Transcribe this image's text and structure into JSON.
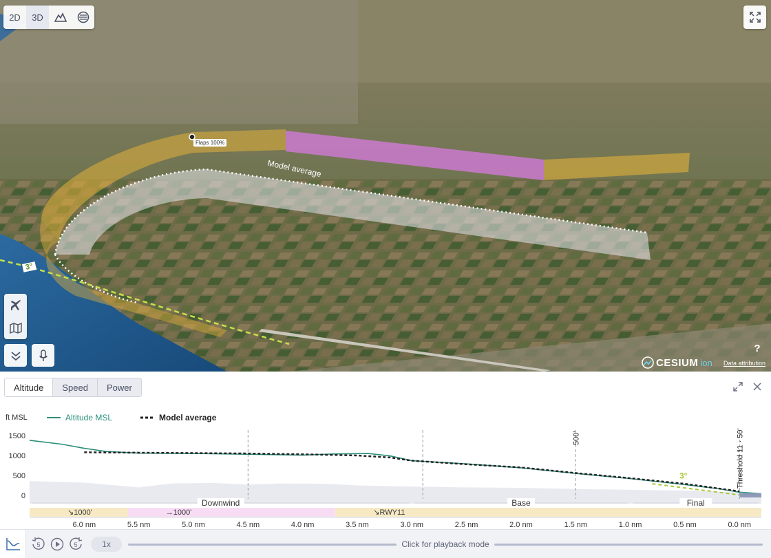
{
  "map": {
    "view_modes": [
      {
        "label": "2D",
        "active": false
      },
      {
        "label": "3D",
        "active": true
      }
    ],
    "icons": {
      "terrain": "mountain-icon",
      "imagery": "globe-icon",
      "fullscreen": "expand-arrows-icon",
      "aircraft": "airplane-icon",
      "map": "map-icon",
      "collapse": "double-chevron-down-icon",
      "mic": "microphone-icon"
    },
    "help_label": "?",
    "labels": {
      "model_average": "Model average",
      "flaps": "Flaps 100%",
      "glide_angle": "3°"
    },
    "cesium": {
      "name": "CESIUM",
      "suffix": "ion",
      "attribution": "Data attribution"
    },
    "colors": {
      "flight_band_yellow": "#e2b03a",
      "flight_band_pink": "#d77be0",
      "model_band": "#e6e7ec",
      "glide_line": "#c6e04a"
    }
  },
  "panel": {
    "tabs": [
      {
        "label": "Altitude",
        "active": true
      },
      {
        "label": "Speed",
        "active": false
      },
      {
        "label": "Power",
        "active": false
      }
    ]
  },
  "chart_data": {
    "type": "line",
    "ylabel": "ft MSL",
    "ylim": [
      -100,
      1650
    ],
    "xlim": [
      6.5,
      -0.2
    ],
    "x_ticks": [
      6.0,
      5.5,
      5.0,
      4.5,
      4.0,
      3.5,
      3.0,
      2.5,
      2.0,
      1.5,
      1.0,
      0.5,
      0.0
    ],
    "x_tick_labels": [
      "6.0 nm",
      "5.5 nm",
      "5.0 nm",
      "4.5 nm",
      "4.0 nm",
      "3.5 nm",
      "3.0 nm",
      "2.5 nm",
      "2.0 nm",
      "1.5 nm",
      "1.0 nm",
      "0.5 nm",
      "0.0 nm"
    ],
    "y_ticks": [
      0,
      500,
      1000,
      1500
    ],
    "y_tick_labels": [
      "0",
      "500",
      "1000",
      "1500"
    ],
    "legend": [
      "Altitude MSL",
      "Model average"
    ],
    "legend_position": "top-left",
    "series": [
      {
        "name": "Altitude MSL",
        "color": "#2a8e7a",
        "x": [
          6.5,
          6.2,
          6.0,
          5.8,
          5.5,
          5.0,
          4.5,
          4.0,
          3.7,
          3.4,
          3.2,
          3.0,
          2.5,
          2.0,
          1.5,
          1.0,
          0.7,
          0.5,
          0.2,
          0.0,
          -0.2
        ],
        "y": [
          1380,
          1280,
          1180,
          1100,
          1060,
          1050,
          1030,
          1010,
          1040,
          1050,
          990,
          870,
          790,
          690,
          550,
          420,
          330,
          270,
          170,
          80,
          40
        ]
      },
      {
        "name": "Model average",
        "color": "#222222",
        "dashed": true,
        "x": [
          6.0,
          5.5,
          5.0,
          4.5,
          4.0,
          3.5,
          3.2,
          3.0,
          2.5,
          2.0,
          1.5,
          1.0,
          0.5,
          0.0
        ],
        "y": [
          1080,
          1070,
          1060,
          1050,
          1030,
          1000,
          950,
          870,
          780,
          700,
          560,
          430,
          290,
          100
        ]
      }
    ],
    "terrain": {
      "x": [
        6.5,
        6.0,
        5.5,
        5.2,
        4.8,
        4.5,
        4.2,
        3.8,
        3.5,
        3.0,
        2.5,
        2.0,
        1.5,
        1.0,
        0.5,
        0.0,
        -0.2
      ],
      "y": [
        360,
        320,
        200,
        300,
        310,
        270,
        300,
        290,
        250,
        220,
        200,
        190,
        160,
        140,
        120,
        80,
        60
      ]
    },
    "vertical_markers": [
      {
        "x": 4.5,
        "label": ""
      },
      {
        "x": 2.9,
        "label": ""
      },
      {
        "x": 1.5,
        "label": "500'"
      },
      {
        "x": 0.0,
        "label": "Threshold 11 · 50'"
      }
    ],
    "glide_slope": {
      "label": "3°",
      "color": "#a8c93a",
      "x": [
        0.8,
        0.0
      ],
      "y": [
        360,
        80
      ]
    },
    "phases": [
      {
        "label": "Downwind",
        "from": 6.5,
        "to": 3.0
      },
      {
        "label": "Base",
        "from": 3.0,
        "to": 1.0
      },
      {
        "label": "Final",
        "from": 1.0,
        "to": -0.2
      }
    ],
    "targets": [
      {
        "label": "↘1000'",
        "from": 6.5,
        "to": 5.6,
        "color": "#f6e9c4"
      },
      {
        "label": "→1000'",
        "from": 5.6,
        "to": 3.7,
        "color": "#f8dcf4"
      },
      {
        "label": "↘RWY11",
        "from": 3.7,
        "to": -0.2,
        "color": "#f6e9c4"
      }
    ]
  },
  "playback": {
    "rewind_label": "5",
    "forward_label": "5",
    "speed_label": "1x",
    "hint": "Click for playback mode"
  }
}
